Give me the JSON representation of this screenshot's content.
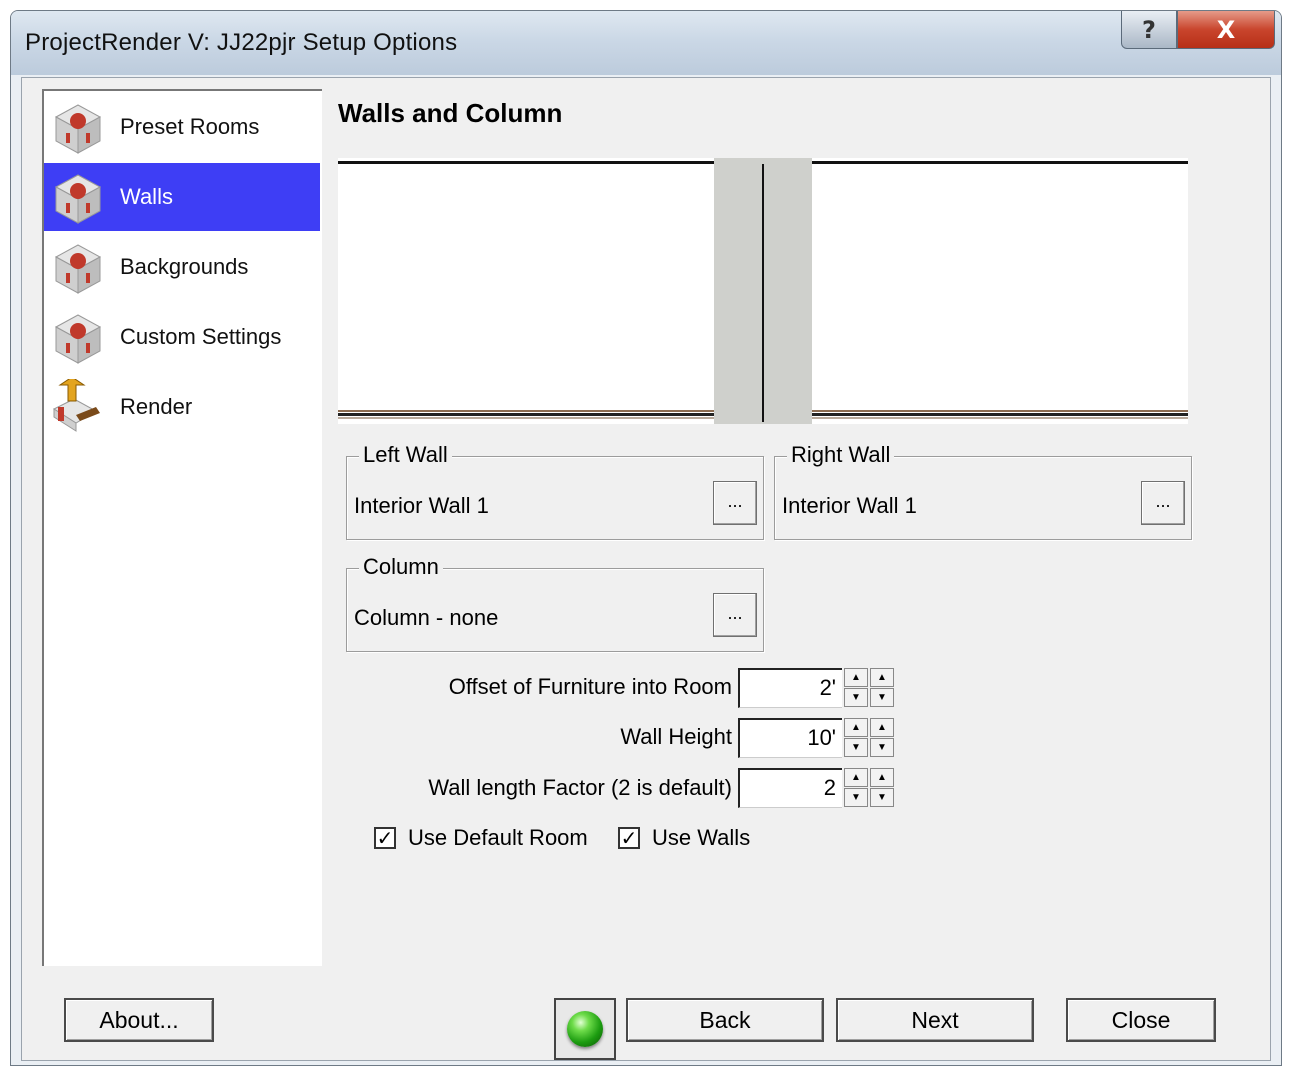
{
  "window": {
    "title": "ProjectRender V:  JJ22pjr Setup Options",
    "help_label": "?",
    "close_label": "X"
  },
  "sidebar": {
    "items": [
      {
        "label": "Preset Rooms",
        "icon": "room-cube-icon",
        "selected": false
      },
      {
        "label": "Walls",
        "icon": "room-cube-icon",
        "selected": true
      },
      {
        "label": "Backgrounds",
        "icon": "room-cube-icon",
        "selected": false
      },
      {
        "label": "Custom Settings",
        "icon": "room-cube-icon",
        "selected": false
      },
      {
        "label": "Render",
        "icon": "render-arrow-icon",
        "selected": false
      }
    ]
  },
  "main": {
    "title": "Walls and Column",
    "left_wall": {
      "legend": "Left Wall",
      "value": "Interior Wall 1",
      "button": "..."
    },
    "right_wall": {
      "legend": "Right Wall",
      "value": "Interior Wall 1",
      "button": "..."
    },
    "column": {
      "legend": "Column",
      "value": "Column - none",
      "button": "..."
    },
    "offset": {
      "label": "Offset of Furniture into Room",
      "value": "2'"
    },
    "wall_height": {
      "label": "Wall Height",
      "value": "10'"
    },
    "wall_length": {
      "label": "Wall length Factor (2 is default)",
      "value": "2"
    },
    "use_default_room": {
      "label": "Use Default Room",
      "checked": true
    },
    "use_walls": {
      "label": "Use Walls",
      "checked": true
    }
  },
  "footer": {
    "about": "About...",
    "back": "Back",
    "next": "Next",
    "close": "Close",
    "status_color": "#22aa11"
  },
  "colors": {
    "selection": "#3e3ef5",
    "close_button": "#c9452d"
  }
}
